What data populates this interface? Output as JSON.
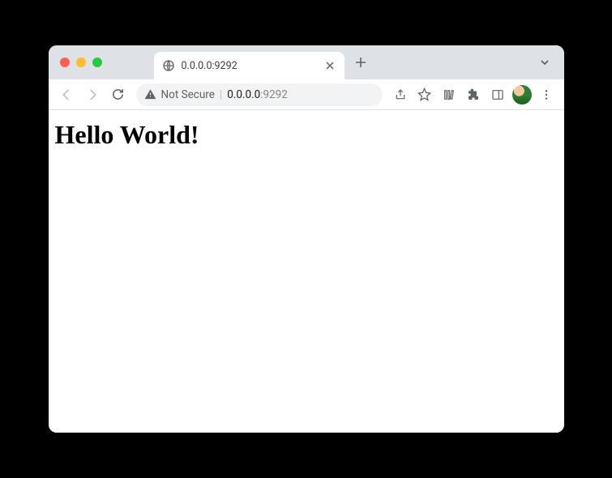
{
  "tab": {
    "title": "0.0.0.0:9292"
  },
  "address": {
    "not_secure_label": "Not Secure",
    "host": "0.0.0.0",
    "port": ":9292"
  },
  "page": {
    "heading": "Hello World!"
  }
}
